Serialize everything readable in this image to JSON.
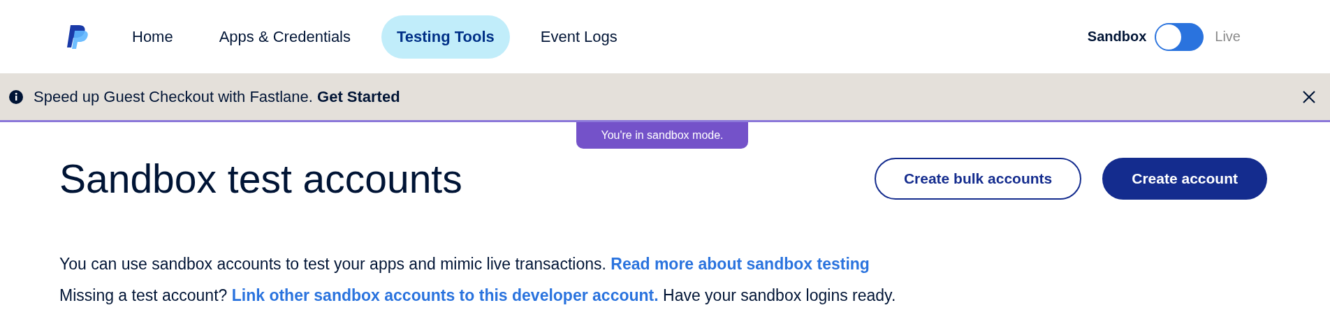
{
  "nav": {
    "items": [
      {
        "label": "Home",
        "selected": false
      },
      {
        "label": "Apps & Credentials",
        "selected": false
      },
      {
        "label": "Testing Tools",
        "selected": true
      },
      {
        "label": "Event Logs",
        "selected": false
      }
    ],
    "environment": {
      "left_label": "Sandbox",
      "right_label": "Live",
      "on": false
    }
  },
  "banner": {
    "text": "Speed up Guest Checkout with Fastlane.",
    "action": "Get Started"
  },
  "mode_notice": "You're in sandbox mode.",
  "heading": "Sandbox test accounts",
  "buttons": [
    {
      "label": "Create bulk accounts",
      "kind": "outline"
    },
    {
      "label": "Create account",
      "kind": "primary"
    }
  ],
  "paragraphs": [
    {
      "before": "You can use sandbox accounts to test your apps and mimic live transactions.",
      "link": "Read more about sandbox testing"
    },
    {
      "before": "Missing a test account?",
      "link": "Link other sandbox accounts to this developer account.",
      "after": "Have your sandbox logins ready."
    }
  ]
}
